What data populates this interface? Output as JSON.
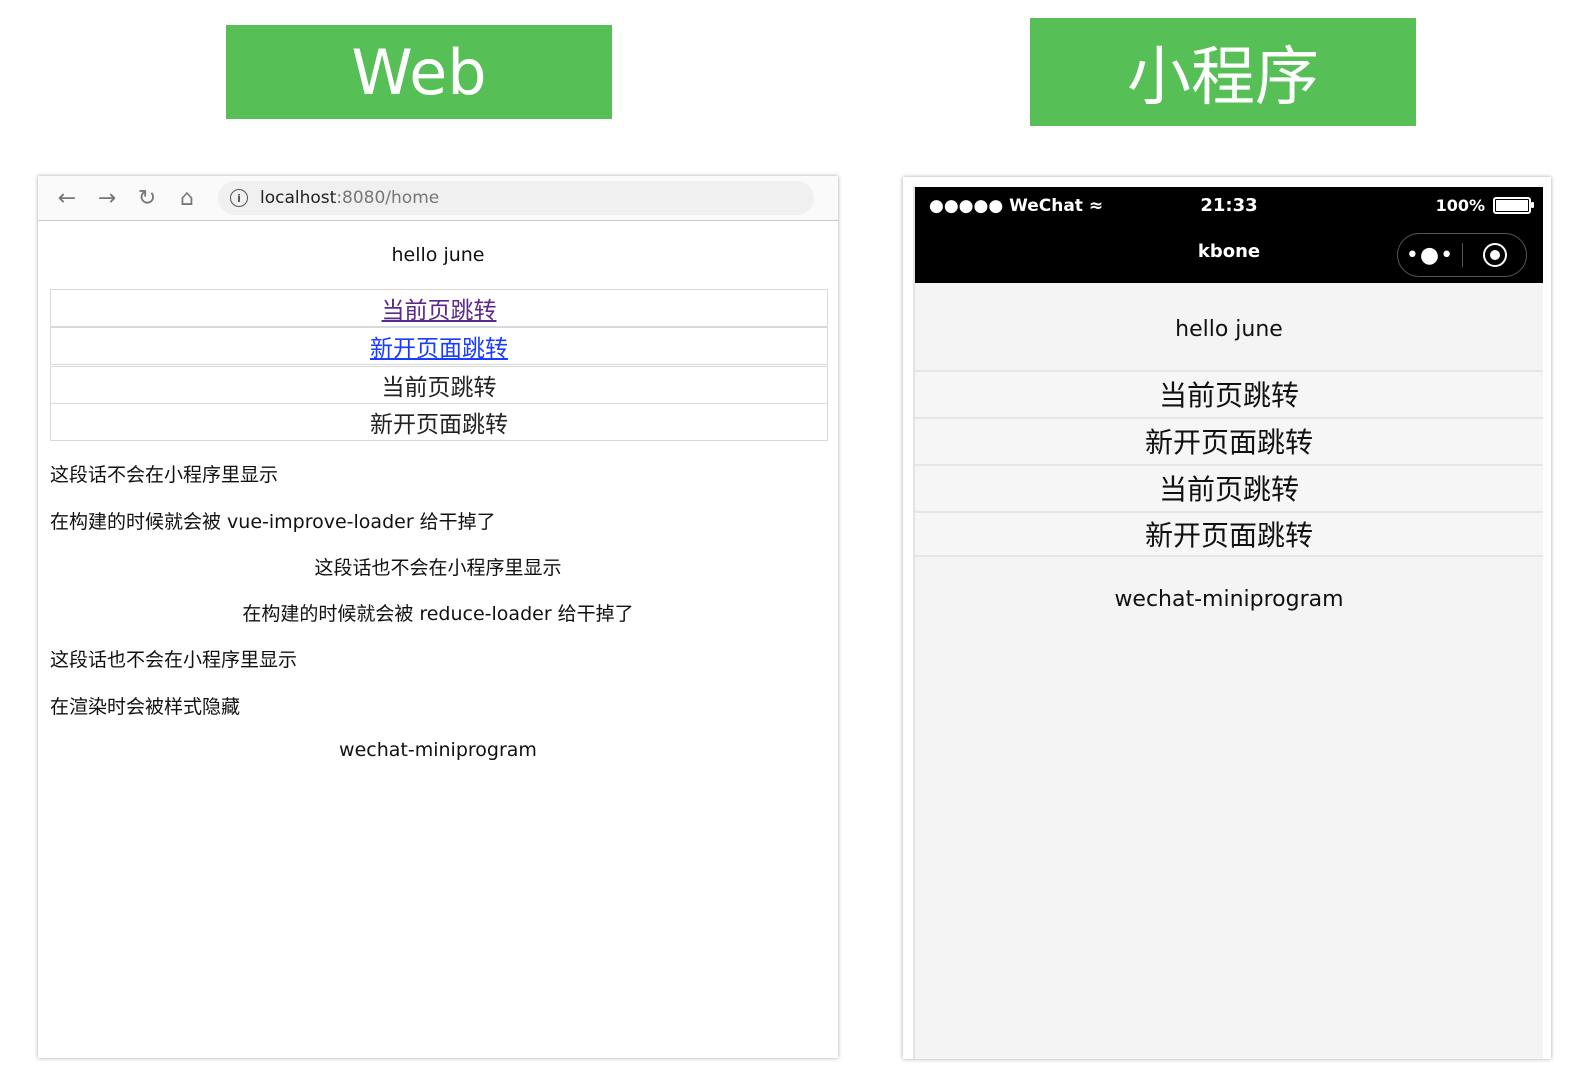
{
  "banners": {
    "web": "Web",
    "miniprogram": "小程序"
  },
  "web": {
    "url_host": "localhost",
    "url_rest": ":8080/home",
    "hello": "hello june",
    "links": [
      {
        "label": "当前页跳转",
        "style": "visited-link"
      },
      {
        "label": "新开页面跳转",
        "style": "link"
      },
      {
        "label": "当前页跳转",
        "style": "plain"
      },
      {
        "label": "新开页面跳转",
        "style": "plain"
      }
    ],
    "texts": [
      "这段话不会在小程序里显示",
      "在构建的时候就会被 vue-improve-loader 给干掉了",
      "这段话也不会在小程序里显示",
      "在构建的时候就会被 reduce-loader 给干掉了",
      "这段话也不会在小程序里显示",
      "在渲染时会被样式隐藏"
    ],
    "footer": "wechat-miniprogram"
  },
  "miniprogram": {
    "status_left": "●●●●● WeChat",
    "time": "21:33",
    "battery": "100%",
    "nav_title": "kbone",
    "capsule_more": "•●•",
    "hello": "hello june",
    "buttons": [
      "当前页跳转",
      "新开页面跳转",
      "当前页跳转",
      "新开页面跳转"
    ],
    "footer": "wechat-miniprogram"
  },
  "colors": {
    "banner": "#56bf56",
    "visited_link": "#5a2a8a",
    "link": "#1a3cff",
    "header": "#000000"
  }
}
